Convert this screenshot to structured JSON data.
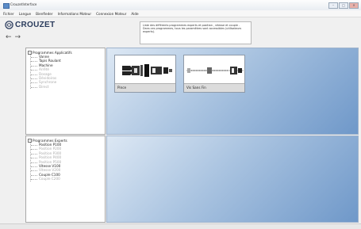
{
  "window": {
    "title": "CrouzetInterface",
    "buttons": [
      "–",
      "□",
      "✕"
    ]
  },
  "menu": [
    "Fichier",
    "Langue",
    "Bienfieder",
    "Informations Moteur",
    "Connexion Moteur",
    "Aide"
  ],
  "brand": {
    "name": "CROUZET",
    "back_icon": "arrow-left-icon",
    "forward_icon": "arrow-right-icon"
  },
  "info": {
    "line1": "Liste des différents programmes experts et position , vitesse et couple .",
    "line2": "Dans ces programmes, tous les paramètres sont accessibles (utilisateurs experts)."
  },
  "tree_apps": {
    "root": "Programmes Applicatifs",
    "items": [
      {
        "label": "Vanne",
        "enabled": true
      },
      {
        "label": "Tapis Roulant",
        "enabled": true
      },
      {
        "label": "Machine",
        "enabled": true
      },
      {
        "label": "Arrêté",
        "enabled": false
      },
      {
        "label": "Dosage",
        "enabled": false
      },
      {
        "label": "Dévidoiros",
        "enabled": false
      },
      {
        "label": "Synchrone",
        "enabled": false
      },
      {
        "label": "Direct",
        "enabled": false
      }
    ]
  },
  "tree_experts": {
    "root": "Programmes Experts",
    "items": [
      {
        "label": "Position P100",
        "enabled": true
      },
      {
        "label": "Position P200",
        "enabled": false
      },
      {
        "label": "Position P300",
        "enabled": false
      },
      {
        "label": "Position P400",
        "enabled": false
      },
      {
        "label": "Position P500",
        "enabled": false
      },
      {
        "label": "Vitesse V100",
        "enabled": true
      },
      {
        "label": "Vitesse V200",
        "enabled": false
      },
      {
        "label": "Couple C100",
        "enabled": true
      },
      {
        "label": "Couple C200",
        "enabled": false
      }
    ]
  },
  "cards": [
    {
      "label": "Pince"
    },
    {
      "label": "Vis Sans Fin"
    }
  ],
  "colors": {
    "accent": "#2a3b5c",
    "content_bg_dark": "#6f98c9"
  }
}
